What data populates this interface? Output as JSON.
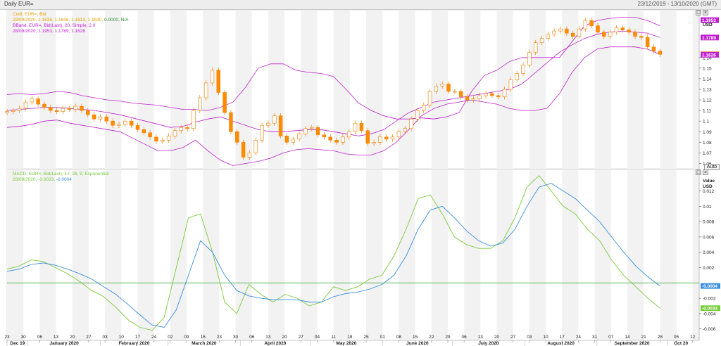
{
  "window": {
    "title": "Daily EUR=",
    "date_range": "23/12/2019 - 13/10/2020 (GMT)"
  },
  "controls": {
    "auto_label": "Auto"
  },
  "colors": {
    "candle_up": "#ffffff",
    "candle_down": "#ff8c00",
    "candle_outline": "#f08000",
    "bband": "#c020d0",
    "macd": "#7acb3a",
    "signal": "#3b8fe0",
    "zero_line": "#2ca02c",
    "badge_last": "#ff8c00",
    "badge_band": "#c020d0",
    "badge_macd": "#7acb3a",
    "badge_signal": "#3b8fe0"
  },
  "price_panel": {
    "legend": [
      {
        "text": "Cndl, EUR=, Bid",
        "color": "#e8a000"
      },
      {
        "text": "28/09/2020, 1.1636, 1.1638, 1.1613, 1.1630, ",
        "color": "#e8a000",
        "extra": "0.0000, N/A",
        "extra_color": "#2e8b2e"
      },
      {
        "text": "BBand, EUR=, Bid(Last), 20, Simple, 2.0",
        "color": "#c020d0"
      },
      {
        "text": "28/09/2020, 1.1953, 1.1789, 1.1626",
        "color": "#c020d0"
      }
    ],
    "axis_title": "Value\nUSD",
    "y_ticks": [
      "1.16",
      "1.15",
      "1.14",
      "1.13",
      "1.12",
      "1.11",
      "1.1",
      "1.09",
      "1.08",
      "1.07",
      "1.06"
    ],
    "badges": [
      {
        "label": "1.1953",
        "value": 1.1953,
        "kind": "band"
      },
      {
        "label": "1.1789",
        "value": 1.1789,
        "kind": "band"
      },
      {
        "label": "1.1630",
        "value": 1.163,
        "kind": "last"
      },
      {
        "label": "1.1626",
        "value": 1.1626,
        "kind": "band"
      }
    ]
  },
  "macd_panel": {
    "legend": [
      {
        "text": "MACD, EUR=, Bid(Last), 12, 26, 9, Exponential",
        "color": "#7acb3a"
      },
      {
        "text": "28/09/2020, ",
        "color": "#7acb3a",
        "v1": "-0.0033",
        "v1_color": "#7acb3a",
        "sep": ", ",
        "v2": "-0.0004",
        "v2_color": "#3b8fe0"
      }
    ],
    "axis_title": "Value\nUSD",
    "y_ticks": [
      "0.012",
      "0.01",
      "0.008",
      "0.006",
      "0.004",
      "0.002",
      "-0.002",
      "-0.004",
      "-0.006"
    ],
    "badges": [
      {
        "label": "-0.0004",
        "value": -0.0004,
        "kind": "signal"
      },
      {
        "label": "-0.0033",
        "value": -0.0033,
        "kind": "macd"
      }
    ]
  },
  "x_axis": {
    "days": [
      "23",
      "30",
      "06",
      "13",
      "20",
      "27",
      "03",
      "10",
      "17",
      "24",
      "02",
      "09",
      "16",
      "23",
      "30",
      "06",
      "13",
      "20",
      "27",
      "04",
      "11",
      "18",
      "25",
      "01",
      "08",
      "15",
      "22",
      "29",
      "06",
      "13",
      "20",
      "27",
      "03",
      "10",
      "17",
      "24",
      "31",
      "07",
      "14",
      "21",
      "28",
      "05",
      "12"
    ],
    "months": [
      "Dec 19",
      "January 2020",
      "February 2020",
      "March 2020",
      "April 2020",
      "May 2020",
      "June 2020",
      "July 2020",
      "August 2020",
      "September 2020",
      "Oct 20"
    ]
  },
  "chart_data": [
    {
      "type": "candlestick",
      "title": "Cndl, EUR=, Bid",
      "ylabel": "Value USD",
      "ylim": [
        1.055,
        1.205
      ],
      "x_start": "2019-12-23",
      "x_end": "2020-10-13",
      "bband_period": 20,
      "bband_std": 2.0,
      "close": [
        1.109,
        1.11,
        1.112,
        1.118,
        1.121,
        1.116,
        1.113,
        1.11,
        1.109,
        1.112,
        1.111,
        1.114,
        1.11,
        1.106,
        1.102,
        1.104,
        1.1,
        1.096,
        1.097,
        1.1,
        1.096,
        1.092,
        1.089,
        1.085,
        1.081,
        1.082,
        1.086,
        1.091,
        1.094,
        1.093,
        1.11,
        1.122,
        1.136,
        1.148,
        1.127,
        1.108,
        1.09,
        1.08,
        1.066,
        1.07,
        1.082,
        1.096,
        1.098,
        1.105,
        1.086,
        1.08,
        1.083,
        1.088,
        1.093,
        1.094,
        1.087,
        1.085,
        1.082,
        1.08,
        1.085,
        1.09,
        1.098,
        1.091,
        1.079,
        1.08,
        1.085,
        1.083,
        1.085,
        1.09,
        1.093,
        1.102,
        1.11,
        1.115,
        1.128,
        1.133,
        1.135,
        1.128,
        1.128,
        1.123,
        1.12,
        1.121,
        1.124,
        1.126,
        1.124,
        1.123,
        1.13,
        1.139,
        1.145,
        1.153,
        1.165,
        1.174,
        1.178,
        1.182,
        1.185,
        1.187,
        1.183,
        1.18,
        1.187,
        1.195,
        1.19,
        1.184,
        1.18,
        1.184,
        1.188,
        1.186,
        1.184,
        1.18,
        1.179,
        1.17,
        1.166,
        1.163
      ],
      "bband_upper": [
        1.125,
        1.126,
        1.125,
        1.126,
        1.128,
        1.127,
        1.124,
        1.122,
        1.12,
        1.119,
        1.117,
        1.116,
        1.115,
        1.113,
        1.111,
        1.111,
        1.11,
        1.113,
        1.118,
        1.132,
        1.15,
        1.154,
        1.154,
        1.148,
        1.146,
        1.145,
        1.142,
        1.13,
        1.117,
        1.11,
        1.105,
        1.102,
        1.102,
        1.103,
        1.102,
        1.104,
        1.108,
        1.128,
        1.143,
        1.148,
        1.156,
        1.16,
        1.16,
        1.16,
        1.16,
        1.175,
        1.19,
        1.195,
        1.197,
        1.198,
        1.198,
        1.195,
        1.19
      ],
      "bband_middle": [
        1.11,
        1.111,
        1.112,
        1.113,
        1.113,
        1.112,
        1.111,
        1.11,
        1.108,
        1.106,
        1.103,
        1.1,
        1.097,
        1.094,
        1.095,
        1.099,
        1.102,
        1.104,
        1.1,
        1.096,
        1.092,
        1.09,
        1.09,
        1.091,
        1.092,
        1.092,
        1.09,
        1.088,
        1.086,
        1.088,
        1.092,
        1.1,
        1.108,
        1.113,
        1.118,
        1.12,
        1.122,
        1.124,
        1.126,
        1.128,
        1.13,
        1.135,
        1.145,
        1.155,
        1.165,
        1.172,
        1.178,
        1.182,
        1.184,
        1.185,
        1.184,
        1.183,
        1.179
      ],
      "bband_lower": [
        1.094,
        1.095,
        1.097,
        1.1,
        1.101,
        1.098,
        1.096,
        1.094,
        1.092,
        1.09,
        1.084,
        1.078,
        1.072,
        1.072,
        1.075,
        1.082,
        1.072,
        1.063,
        1.058,
        1.06,
        1.062,
        1.065,
        1.07,
        1.073,
        1.074,
        1.073,
        1.072,
        1.069,
        1.068,
        1.068,
        1.072,
        1.08,
        1.092,
        1.105,
        1.112,
        1.116,
        1.118,
        1.12,
        1.118,
        1.116,
        1.112,
        1.11,
        1.11,
        1.112,
        1.126,
        1.146,
        1.16,
        1.168,
        1.17,
        1.17,
        1.17,
        1.168,
        1.163
      ]
    },
    {
      "type": "line",
      "title": "MACD, EUR=, Bid(Last), 12, 26, 9, Exponential",
      "ylabel": "Value USD",
      "ylim": [
        -0.0075,
        0.0148
      ],
      "x_start": "2019-12-23",
      "x_end": "2020-10-13",
      "series": [
        {
          "name": "MACD",
          "values": [
            0.0018,
            0.0022,
            0.003,
            0.0028,
            0.002,
            0.0012,
            0.0002,
            -0.001,
            -0.0018,
            -0.0032,
            -0.0048,
            -0.0058,
            -0.0062,
            -0.0045,
            0.002,
            0.0085,
            0.009,
            0.004,
            -0.0025,
            -0.004,
            -0.0002,
            -0.0015,
            -0.0025,
            -0.0015,
            -0.002,
            -0.003,
            -0.0025,
            -0.0005,
            -0.001,
            -0.0005,
            0.0005,
            0.001,
            0.0035,
            0.007,
            0.011,
            0.0115,
            0.009,
            0.006,
            0.005,
            0.0045,
            0.0045,
            0.0055,
            0.0085,
            0.0125,
            0.014,
            0.012,
            0.01,
            0.009,
            0.007,
            0.0055,
            0.003,
            0.001,
            -0.0005,
            -0.002,
            -0.0033
          ]
        },
        {
          "name": "Signal",
          "values": [
            0.0015,
            0.0018,
            0.0024,
            0.0026,
            0.0023,
            0.0018,
            0.0012,
            0.0005,
            -0.0005,
            -0.0015,
            -0.0028,
            -0.0042,
            -0.0055,
            -0.0058,
            -0.0035,
            0.001,
            0.0055,
            0.004,
            0.001,
            -0.001,
            -0.0017,
            -0.002,
            -0.0022,
            -0.0022,
            -0.0022,
            -0.0025,
            -0.0025,
            -0.0018,
            -0.0014,
            -0.0012,
            -0.0008,
            -0.0002,
            0.001,
            0.0035,
            0.007,
            0.0095,
            0.01,
            0.0085,
            0.0068,
            0.0055,
            0.0048,
            0.0052,
            0.007,
            0.01,
            0.0125,
            0.013,
            0.012,
            0.011,
            0.0095,
            0.008,
            0.006,
            0.004,
            0.0022,
            0.0008,
            -0.0004
          ]
        }
      ]
    }
  ]
}
